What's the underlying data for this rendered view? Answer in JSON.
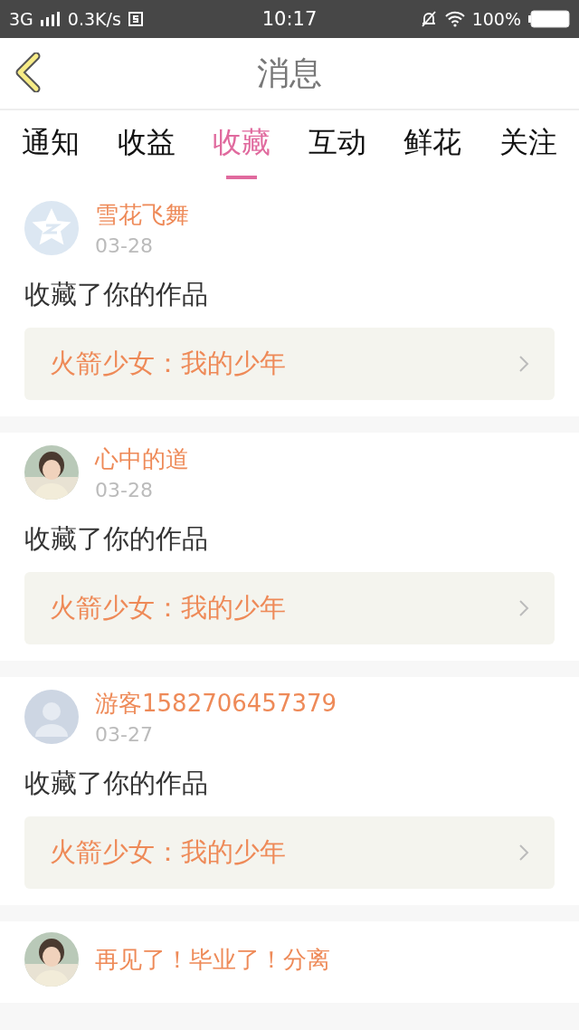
{
  "status_bar": {
    "network": "3G",
    "speed": "0.3K/s",
    "time": "10:17",
    "battery": "100%"
  },
  "header": {
    "title": "消息"
  },
  "tabs": [
    {
      "label": "通知",
      "selected": false
    },
    {
      "label": "收益",
      "selected": false
    },
    {
      "label": "收藏",
      "selected": true
    },
    {
      "label": "互动",
      "selected": false
    },
    {
      "label": "鲜花",
      "selected": false
    },
    {
      "label": "关注",
      "selected": false
    }
  ],
  "messages": [
    {
      "kind": "star",
      "user": "雪花飞舞",
      "date": "03-28",
      "text": "收藏了你的作品",
      "work": "火箭少女：我的少年"
    },
    {
      "kind": "picture",
      "user": "心中的道",
      "date": "03-28",
      "text": "收藏了你的作品",
      "work": "火箭少女：我的少年"
    },
    {
      "kind": "default",
      "user": "游客1582706457379",
      "date": "03-27",
      "text": "收藏了你的作品",
      "work": "火箭少女：我的少年"
    },
    {
      "kind": "picture",
      "user": "再见了！毕业了！分离"
    }
  ]
}
